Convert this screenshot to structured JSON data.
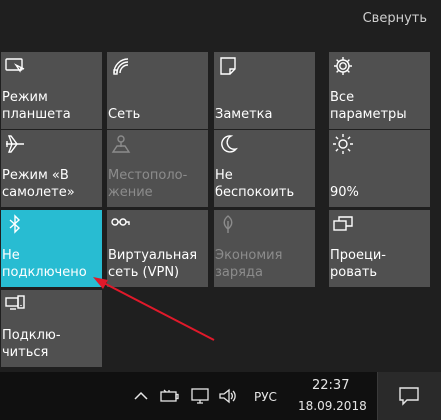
{
  "header": {
    "collapse_label": "Свернуть"
  },
  "tiles": [
    {
      "label": "Режим\nпланшета",
      "icon": "tablet-mode-icon",
      "state": "normal"
    },
    {
      "label": "Сеть",
      "icon": "network-icon",
      "state": "normal"
    },
    {
      "label": "Заметка",
      "icon": "note-icon",
      "state": "normal"
    },
    {
      "label": "Все\nпараметры",
      "icon": "settings-gear-icon",
      "state": "normal"
    },
    {
      "label": "Режим «В\nсамолете»",
      "icon": "airplane-icon",
      "state": "normal"
    },
    {
      "label": "Местополо-\nжение",
      "icon": "location-icon",
      "state": "disabled"
    },
    {
      "label": "Не\nбеспокоить",
      "icon": "moon-icon",
      "state": "normal"
    },
    {
      "label": "90%",
      "icon": "brightness-icon",
      "state": "normal"
    },
    {
      "label": "Не\nподключено",
      "icon": "bluetooth-icon",
      "state": "active"
    },
    {
      "label": "Виртуальная\nсеть (VPN)",
      "icon": "vpn-icon",
      "state": "normal"
    },
    {
      "label": "Экономия\nзаряда",
      "icon": "battery-saver-icon",
      "state": "disabled"
    },
    {
      "label": "Проеци-\nровать",
      "icon": "project-icon",
      "state": "normal"
    },
    {
      "label": "Подклю-\nчиться",
      "icon": "connect-icon",
      "state": "normal"
    }
  ],
  "taskbar": {
    "language": "РУС",
    "time": "22:37",
    "date": "18.09.2018",
    "icons": [
      "chevron-up-icon",
      "battery-icon",
      "display-icon",
      "volume-icon"
    ]
  },
  "colors": {
    "background": "#1f1f1f",
    "tile": "#505050",
    "tile_active": "#28bcd2",
    "taskbar": "#101010",
    "annotation_arrow": "#e0192a"
  }
}
